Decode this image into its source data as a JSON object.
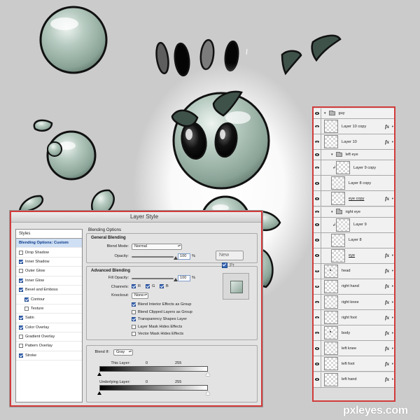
{
  "colors": {
    "background": "#cbcbcb",
    "dialog_border": "#d23b3b",
    "character_fill": "#9fb5aa",
    "dark_shape": "#3a4a42",
    "selected_row": "#cfe0f4"
  },
  "dialog": {
    "title": "Layer Style",
    "styles_header": "Styles",
    "styles": [
      {
        "label": "Blending Options: Custom",
        "checked": null,
        "selected": true,
        "indent": false
      },
      {
        "label": "Drop Shadow",
        "checked": false,
        "selected": false,
        "indent": false
      },
      {
        "label": "Inner Shadow",
        "checked": true,
        "selected": false,
        "indent": false
      },
      {
        "label": "Outer Glow",
        "checked": false,
        "selected": false,
        "indent": false
      },
      {
        "label": "Inner Glow",
        "checked": true,
        "selected": false,
        "indent": false
      },
      {
        "label": "Bevel and Emboss",
        "checked": true,
        "selected": false,
        "indent": false
      },
      {
        "label": "Contour",
        "checked": true,
        "selected": false,
        "indent": true
      },
      {
        "label": "Texture",
        "checked": false,
        "selected": false,
        "indent": true
      },
      {
        "label": "Satin",
        "checked": true,
        "selected": false,
        "indent": false
      },
      {
        "label": "Color Overlay",
        "checked": true,
        "selected": false,
        "indent": false
      },
      {
        "label": "Gradient Overlay",
        "checked": false,
        "selected": false,
        "indent": false
      },
      {
        "label": "Pattern Overlay",
        "checked": false,
        "selected": false,
        "indent": false
      },
      {
        "label": "Stroke",
        "checked": true,
        "selected": false,
        "indent": false
      }
    ],
    "blending_options_title": "Blending Options",
    "general_title": "General Blending",
    "blend_mode_label": "Blend Mode:",
    "blend_mode_value": "Normal",
    "opacity_label": "Opacity:",
    "opacity_value": "100",
    "opacity_unit": "%",
    "advanced_title": "Advanced Blending",
    "fill_opacity_label": "Fill Opacity:",
    "fill_opacity_value": "100",
    "fill_opacity_unit": "%",
    "channels_label": "Channels:",
    "channel_r": "R",
    "channel_g": "G",
    "channel_b": "B",
    "knockout_label": "Knockout:",
    "knockout_value": "None",
    "options": [
      {
        "label": "Blend Interior Effects as Group",
        "checked": true
      },
      {
        "label": "Blend Clipped Layers as Group",
        "checked": false
      },
      {
        "label": "Transparency Shapes Layer",
        "checked": true
      },
      {
        "label": "Layer Mask Hides Effects",
        "checked": false
      },
      {
        "label": "Vector Mask Hides Effects",
        "checked": false
      }
    ],
    "blend_if_label": "Blend If:",
    "blend_if_value": "Gray",
    "this_layer_label": "This Layer:",
    "this_layer_min": "0",
    "this_layer_max": "255",
    "underlying_label": "Underlying Layer:",
    "underlying_min": "0",
    "underlying_max": "255",
    "new_style_label": "New",
    "preview_label": "Pr"
  },
  "layers": [
    {
      "type": "group",
      "name": "guy",
      "indent": 0,
      "fx": false
    },
    {
      "type": "layer",
      "name": "Layer 10 copy",
      "indent": 0,
      "fx": true
    },
    {
      "type": "layer",
      "name": "Layer 10",
      "indent": 0,
      "fx": true
    },
    {
      "type": "group",
      "name": "left eye",
      "indent": 1,
      "fx": false
    },
    {
      "type": "layer",
      "name": "Layer 9 copy",
      "indent": 1,
      "fx": false,
      "clip": true
    },
    {
      "type": "layer",
      "name": "Layer 8 copy",
      "indent": 1,
      "fx": false
    },
    {
      "type": "layer",
      "name": "eye copy",
      "indent": 1,
      "fx": true,
      "underline": true
    },
    {
      "type": "group",
      "name": "right eye",
      "indent": 1,
      "fx": false
    },
    {
      "type": "layer",
      "name": "Layer 9",
      "indent": 1,
      "fx": false,
      "clip": true
    },
    {
      "type": "layer",
      "name": "Layer 8",
      "indent": 1,
      "fx": false
    },
    {
      "type": "layer",
      "name": "eye",
      "indent": 1,
      "fx": true,
      "underline": true
    },
    {
      "type": "layer",
      "name": "head",
      "indent": 0,
      "fx": true,
      "dot": true
    },
    {
      "type": "layer",
      "name": "right hand",
      "indent": 0,
      "fx": true
    },
    {
      "type": "layer",
      "name": "right knee",
      "indent": 0,
      "fx": true
    },
    {
      "type": "layer",
      "name": "right foot",
      "indent": 0,
      "fx": true
    },
    {
      "type": "layer",
      "name": "body",
      "indent": 0,
      "fx": true,
      "dot": true
    },
    {
      "type": "layer",
      "name": "left knee",
      "indent": 0,
      "fx": true
    },
    {
      "type": "layer",
      "name": "left foot",
      "indent": 0,
      "fx": true
    },
    {
      "type": "layer",
      "name": "left hand",
      "indent": 0,
      "fx": true
    }
  ],
  "icons": {
    "visibility": "eye-icon",
    "folder": "folder-icon",
    "effects": "fx-icon",
    "collapse": "triangle-down-icon",
    "clip": "clip-arrow-icon"
  },
  "watermark": "pxleyes.com"
}
